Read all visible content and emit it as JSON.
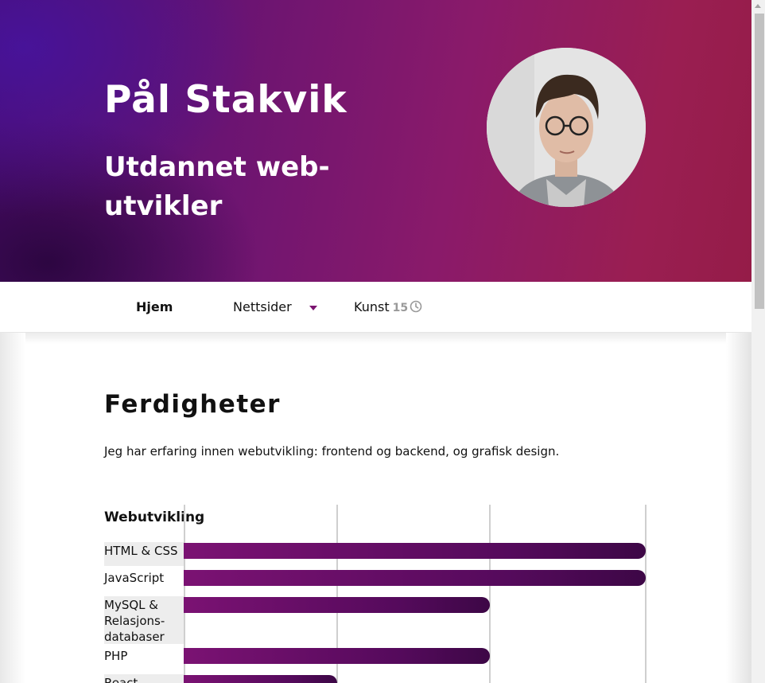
{
  "hero": {
    "name": "Pål Stakvik",
    "title": "Utdannet web-utvikler",
    "avatar_icon": "profile-photo"
  },
  "nav": {
    "items": [
      {
        "label": "Hjem",
        "active": true
      },
      {
        "label": "Nettsider",
        "has_dropdown": true
      },
      {
        "label": "Kunst",
        "badge": "15",
        "icon": "clock-icon"
      }
    ]
  },
  "skills": {
    "heading": "Ferdigheter",
    "intro": "Jeg har erfaring innen webutvikling: frontend og backend, og grafisk design.",
    "group": "Webutvikling",
    "scale_max": 3,
    "items": [
      {
        "label": "HTML & CSS",
        "level": 3
      },
      {
        "label": "JavaScript",
        "level": 3
      },
      {
        "label": "MySQL & Relasjons-databaser",
        "level": 2
      },
      {
        "label": "PHP",
        "level": 2
      },
      {
        "label": "React",
        "level": 1
      }
    ]
  },
  "colors": {
    "accent": "#7b1273",
    "hero_start": "#4a0c6e",
    "hero_end": "#951c48"
  }
}
